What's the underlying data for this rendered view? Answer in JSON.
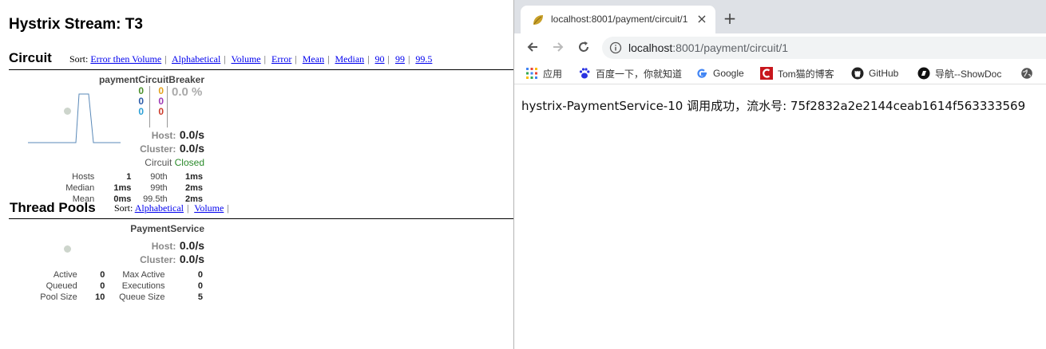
{
  "dashboard": {
    "title": "Hystrix Stream: T3",
    "circuit_section": {
      "heading": "Circuit",
      "sort_label": "Sort:",
      "sort_links": [
        "Error then Volume",
        "Alphabetical",
        "Volume",
        "Error",
        "Mean",
        "Median",
        "90",
        "99",
        "99.5"
      ]
    },
    "circuit": {
      "name": "paymentCircuitBreaker",
      "counts_left": [
        "0",
        "0",
        "0"
      ],
      "counts_right": [
        "0",
        "0",
        "0"
      ],
      "error_pct": "0.0 %",
      "host_label": "Host:",
      "host_rate": "0.0/s",
      "cluster_label": "Cluster:",
      "cluster_rate": "0.0/s",
      "circuit_label": "Circuit",
      "circuit_state": "Closed",
      "stats": [
        [
          "Hosts",
          "1",
          "90th",
          "1ms"
        ],
        [
          "Median",
          "1ms",
          "99th",
          "2ms"
        ],
        [
          "Mean",
          "0ms",
          "99.5th",
          "2ms"
        ]
      ],
      "colors": {
        "success": "#4a8f2a",
        "short_circuited": "#2a5aa8",
        "bad_request": "#2a9fd6",
        "timeout": "#e3a11b",
        "rejected": "#9e3ab5",
        "failure": "#cc3a2a",
        "closed": "#2a8a2a"
      }
    },
    "thread_pools_section": {
      "heading": "Thread Pools",
      "sort_label": "Sort:",
      "sort_links": [
        "Alphabetical",
        "Volume"
      ]
    },
    "thread_pool": {
      "name": "PaymentService",
      "host_label": "Host:",
      "host_rate": "0.0/s",
      "cluster_label": "Cluster:",
      "cluster_rate": "0.0/s",
      "stats": [
        [
          "Active",
          "0",
          "Max Active",
          "0"
        ],
        [
          "Queued",
          "0",
          "Executions",
          "0"
        ],
        [
          "Pool Size",
          "10",
          "Queue Size",
          "5"
        ]
      ]
    }
  },
  "browser": {
    "tab_title": "localhost:8001/payment/circuit/1",
    "close_icon": "×",
    "new_tab_icon": "+",
    "url_host": "localhost",
    "url_path": ":8001/payment/circuit/1",
    "bookmarks": [
      {
        "label": "应用",
        "icon": "apps-grid-icon"
      },
      {
        "label": "百度一下，你就知道",
        "icon": "baidu-paw-icon"
      },
      {
        "label": "Google",
        "icon": "google-g-icon"
      },
      {
        "label": "Tom猫的博客",
        "icon": "red-c-icon"
      },
      {
        "label": "GitHub",
        "icon": "github-icon"
      },
      {
        "label": "导航--ShowDoc",
        "icon": "showdoc-icon"
      },
      {
        "label": "",
        "icon": "globe-icon"
      }
    ],
    "page_text": "hystrix-PaymentService-10 调用成功，流水号: 75f2832a2e2144ceab1614f563333569"
  }
}
